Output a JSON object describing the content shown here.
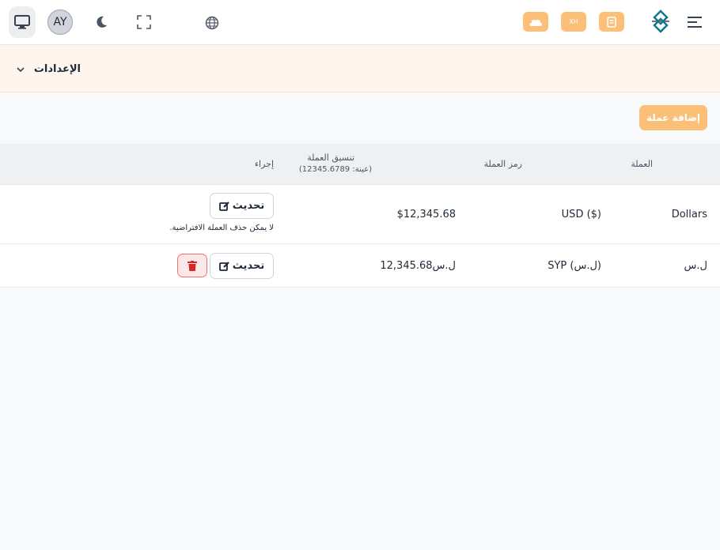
{
  "topbar": {
    "avatar_initials": "AY",
    "quick_button_3_text": "XH"
  },
  "settings": {
    "title": "الإعدادات"
  },
  "add_button_label": "إضافة عملة",
  "table": {
    "headers": {
      "currency": "العملة",
      "symbol": "رمز العملة",
      "format": "تنسيق العملة",
      "format_sample": "(عينة: 12345.6789)",
      "action": "إجراء"
    },
    "rows": [
      {
        "currency": "Dollars",
        "symbol": "USD ($)",
        "format": "$12,345.68",
        "update_label": "تحديث",
        "note": "لا يمكن حذف العملة الافتراضية."
      },
      {
        "currency": "ل.س",
        "symbol": "SYP (ل.س)",
        "format": "ل.س12,345.68",
        "update_label": "تحديث"
      }
    ]
  },
  "colors": {
    "accent": "#fbbf78",
    "danger": "#dc2626",
    "band": "#fdf5ee"
  }
}
